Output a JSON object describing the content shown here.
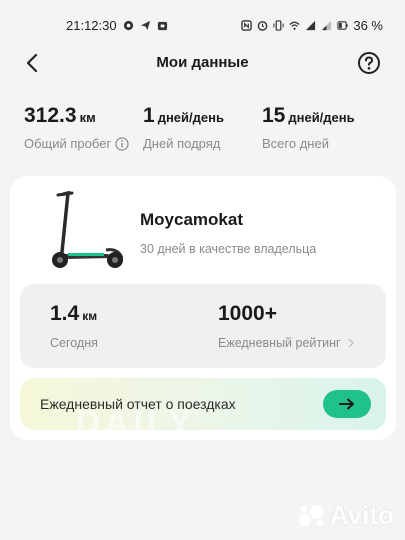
{
  "status_bar": {
    "time": "21:12:30",
    "battery": "36 %",
    "icons": [
      "chat-icon",
      "send-icon",
      "shop-icon",
      "nfc-icon",
      "alarm-icon",
      "vibrate-icon",
      "wifi-icon",
      "signal-icon",
      "battery-icon"
    ]
  },
  "header": {
    "title": "Мои данные",
    "back_icon": "chevron-left-icon",
    "help_icon": "question-circle-icon"
  },
  "stats": [
    {
      "value": "312.3",
      "unit": "км",
      "label": "Общий пробег"
    },
    {
      "value": "1",
      "unit": "дней/день",
      "label": "Дней подряд"
    },
    {
      "value": "15",
      "unit": "дней/день",
      "label": "Всего дней"
    }
  ],
  "scooter": {
    "name": "Moycamokat",
    "subtitle": "30 дней в качестве владельца"
  },
  "today": {
    "value": "1.4",
    "unit": "км",
    "label": "Сегодня"
  },
  "rating": {
    "value": "1000+",
    "label": "Ежедневный рейтинг"
  },
  "report": {
    "label": "Ежедневный отчет о поездках",
    "watermark": "DAILY"
  },
  "watermark": {
    "text": "Avito"
  },
  "colors": {
    "accent": "#1fc38a",
    "background": "#f2f4f5",
    "card": "#ffffff"
  }
}
